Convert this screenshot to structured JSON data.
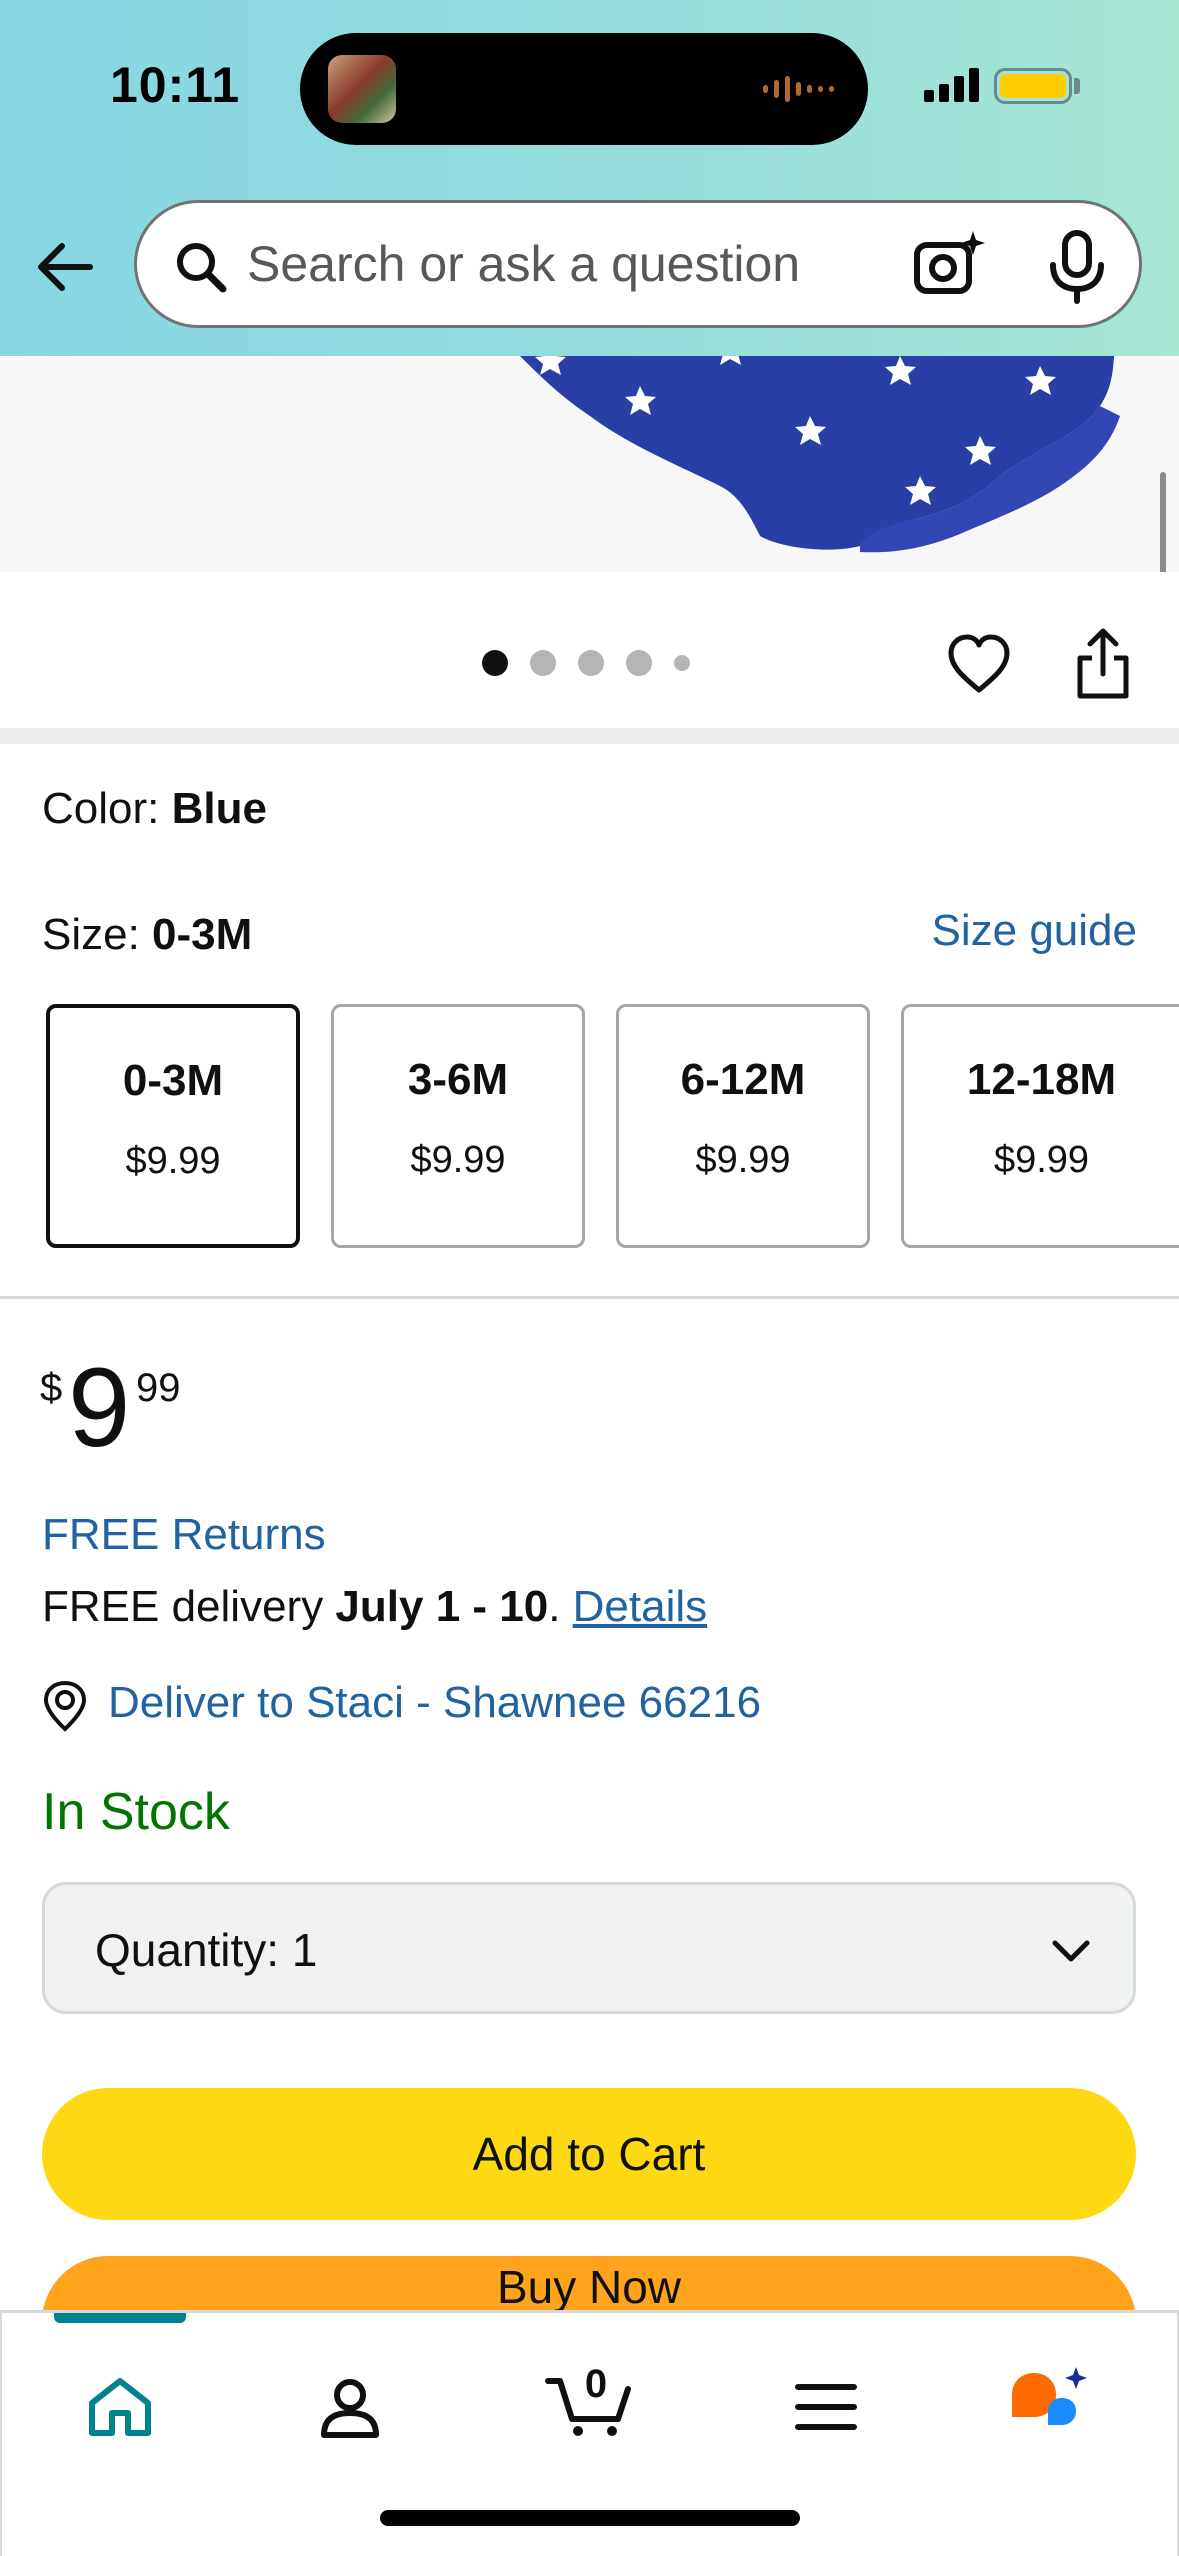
{
  "status_bar": {
    "time": "10:11"
  },
  "header": {
    "search_placeholder": "Search or ask a question"
  },
  "product": {
    "image_count": 5,
    "active_image_index": 0,
    "color_label": "Color: ",
    "color_value": "Blue",
    "size_label": "Size: ",
    "size_value": "0-3M",
    "size_guide": "Size guide",
    "sizes": [
      {
        "label": "0-3M",
        "price": "$9.99",
        "selected": true
      },
      {
        "label": "3-6M",
        "price": "$9.99",
        "selected": false
      },
      {
        "label": "6-12M",
        "price": "$9.99",
        "selected": false
      },
      {
        "label": "12-18M",
        "price": "$9.99",
        "selected": false
      }
    ],
    "price": {
      "symbol": "$",
      "whole": "9",
      "fraction": "99"
    },
    "free_returns": "FREE Returns",
    "delivery": {
      "prefix": "FREE delivery ",
      "dates": "July 1 - 10",
      "suffix": ". ",
      "details_link": "Details"
    },
    "deliver_to": "Deliver to Staci - Shawnee 66216",
    "stock_status": "In Stock",
    "quantity": {
      "label": "Quantity:",
      "value": "1"
    },
    "add_to_cart": "Add to Cart",
    "buy_now": "Buy Now"
  },
  "tabbar": {
    "cart_count": "0",
    "active_tab": "home",
    "tabs": [
      "home",
      "account",
      "cart",
      "menu",
      "rufus"
    ]
  },
  "colors": {
    "header_gradient_start": "#86d6e1",
    "header_gradient_end": "#a6e6d3",
    "link_blue": "#2162a1",
    "in_stock_green": "#007600",
    "add_to_cart_yellow": "#ffd814",
    "buy_now_orange": "#ffa41c",
    "active_tab_teal": "#00838f"
  }
}
